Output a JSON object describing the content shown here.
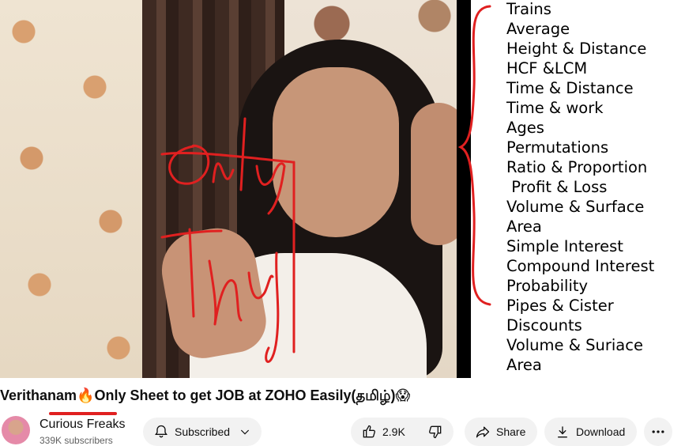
{
  "video": {
    "topics": [
      "Trains",
      "Average",
      "Height & Distance",
      "HCF &LCM",
      "Time & Distance",
      "Time & work",
      "Ages",
      "Permutations",
      "Ratio & Proportion",
      " Profit & Loss",
      "Volume & Surface",
      "Area",
      "Simple Interest",
      "Compound Interest",
      "Probability",
      "Pipes & Cister",
      "Discounts",
      "Volume & Suriace",
      "Area"
    ]
  },
  "title": {
    "text": "Verithanam",
    "fire_emoji": "🔥",
    "text2": "Only Sheet to get JOB at ZOHO Easily(தமிழ்)",
    "shock_emoji": "😱"
  },
  "channel": {
    "name": "Curious Freaks",
    "subscribers": "339K subscribers"
  },
  "actions": {
    "subscribed_label": "Subscribed",
    "like_count": "2.9K",
    "share_label": "Share",
    "download_label": "Download"
  },
  "colors": {
    "annotation_red": "#e02020",
    "button_bg": "#f2f2f2"
  }
}
